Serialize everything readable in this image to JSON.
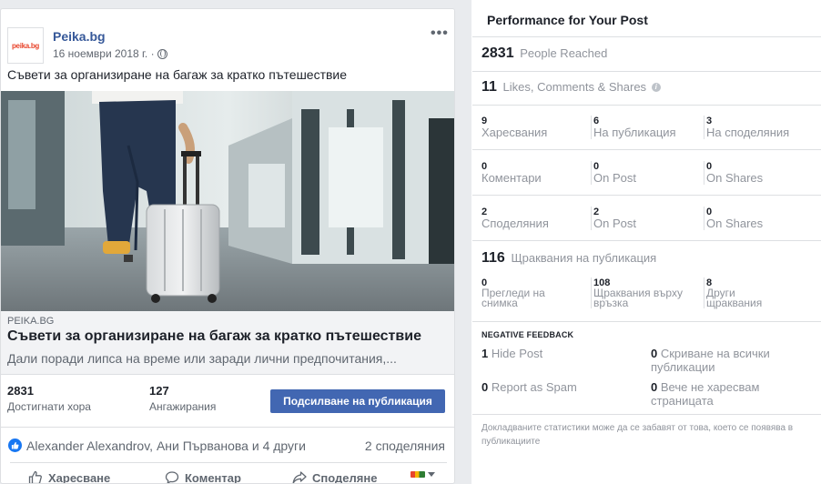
{
  "post": {
    "page_name": "Peika.bg",
    "logo_text": "peika.bg",
    "date": "16 ноември 2018 г. ·",
    "text": "Съвети за организиране на багаж за кратко пътешествие",
    "more_label": "•••",
    "link": {
      "domain": "PEIKA.BG",
      "title": "Съвети за организиране на багаж за кратко пътешествие",
      "description": "Дали поради липса на време или заради лични предпочитания,..."
    },
    "stats": {
      "reached_value": "2831",
      "reached_label": "Достигнати хора",
      "engagements_value": "127",
      "engagements_label": "Ангажирания"
    },
    "boost_label": "Подсилване на публикация",
    "reactors": "Alexander Alexandrov, Ани Първанова и 4 други",
    "shares": "2 споделяния",
    "actions": {
      "like": "Харесване",
      "comment": "Коментар",
      "share": "Споделяне"
    }
  },
  "performance": {
    "title": "Performance for Your Post",
    "reach": {
      "value": "2831",
      "label": "People Reached"
    },
    "engagement": {
      "value": "11",
      "label": "Likes, Comments & Shares"
    },
    "rows": [
      [
        {
          "n": "9",
          "l": "Харесвания"
        },
        {
          "n": "6",
          "l": "На публикация"
        },
        {
          "n": "3",
          "l": "На споделяния"
        }
      ],
      [
        {
          "n": "0",
          "l": "Коментари"
        },
        {
          "n": "0",
          "l": "On Post"
        },
        {
          "n": "0",
          "l": "On Shares"
        }
      ],
      [
        {
          "n": "2",
          "l": "Споделяния"
        },
        {
          "n": "2",
          "l": "On Post"
        },
        {
          "n": "0",
          "l": "On Shares"
        }
      ]
    ],
    "clicks": {
      "value": "116",
      "label": "Щраквания на публикация"
    },
    "click_breakdown": [
      {
        "n": "0",
        "l": "Прегледи на снимка"
      },
      {
        "n": "108",
        "l": "Щраквания върху връзка"
      },
      {
        "n": "8",
        "l": "Други щраквания"
      }
    ],
    "negative_feedback": {
      "heading": "NEGATIVE FEEDBACK",
      "hide_post": {
        "n": "1",
        "l": "Hide Post"
      },
      "hide_all": {
        "n": "0",
        "l": "Скриване на всички публикации"
      },
      "spam": {
        "n": "0",
        "l": "Report as Spam"
      },
      "unlike": {
        "n": "0",
        "l": "Вече не харесвам страницата"
      }
    },
    "footnote": "Докладваните статистики може да се забавят от това, което се появява в публикациите"
  },
  "colors": {
    "brand_blue": "#4267b2",
    "link_blue": "#365899",
    "muted_text": "#90949c",
    "divider": "#dddfe2"
  }
}
